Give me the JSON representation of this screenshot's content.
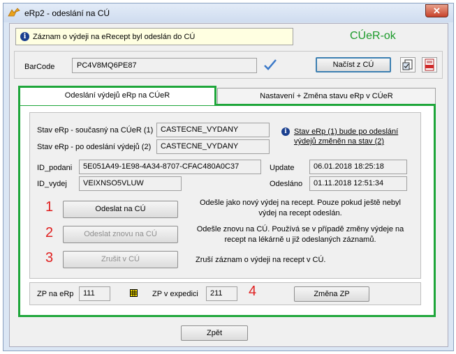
{
  "window": {
    "title": "eRp2 - odeslání na CÚ",
    "close_label": "✕"
  },
  "info_bar": {
    "text": "Záznam o výdeji na eRecept byl odeslán do CÚ"
  },
  "status": "CÚeR-ok",
  "barcode": {
    "label": "BarCode",
    "value": "PC4V8MQ6PE87",
    "load_button": "Načíst z CÚ"
  },
  "tabs": [
    {
      "label": "Odeslání výdejů eRp na CÚeR",
      "active": true
    },
    {
      "label": "Nastavení + Změna stavu eRp v CÚeR",
      "active": false
    }
  ],
  "state": {
    "current_label": "Stav eRp - současný na CÚeR (1)",
    "current_value": "CASTECNE_VYDANY",
    "after_label": "Stav eRp - po odeslání výdejů (2)",
    "after_value": "CASTECNE_VYDANY",
    "link_text_line1": "Stav eRp (1) bude po odeslání",
    "link_text_line2": "výdejů změněn na stav (2)"
  },
  "ids": {
    "podani_label": "ID_podani",
    "podani_value": "5E051A49-1E98-4A34-8707-CFAC480A0C37",
    "vydej_label": "ID_vydej",
    "vydej_value": "VEIXNSO5VLUW",
    "update_label": "Update",
    "update_value": "06.01.2018 18:25:18",
    "sent_label": "Odesláno",
    "sent_value": "01.11.2018 12:51:34"
  },
  "actions": [
    {
      "number": "1",
      "button": "Odeslat na CÚ",
      "enabled": true,
      "desc_line1": "Odešle jako nový výdej na recept. Pouze pokud ještě nebyl",
      "desc_line2": "výdej na recept odeslán."
    },
    {
      "number": "2",
      "button": "Odeslat znovu na CÚ",
      "enabled": false,
      "desc_line1": "Odešle znovu na CÚ. Používá se v případě změny výdeje  na",
      "desc_line2": "recept na lékárně u již odeslaných záznamů."
    },
    {
      "number": "3",
      "button": "Zrušit v CÚ",
      "enabled": false,
      "desc_line1": "Zruší záznam o výdeji  na recept v CÚ.",
      "desc_line2": ""
    }
  ],
  "zp": {
    "erp_label": "ZP na eRp",
    "erp_value": "111",
    "exp_label": "ZP v expedici",
    "exp_value": "211",
    "number": "4",
    "change_button": "Změna ZP"
  },
  "back_button": "Zpět",
  "colors": {
    "accent_green": "#1ea63a",
    "status_green": "#1b9a2a",
    "number_red": "#e02020"
  }
}
